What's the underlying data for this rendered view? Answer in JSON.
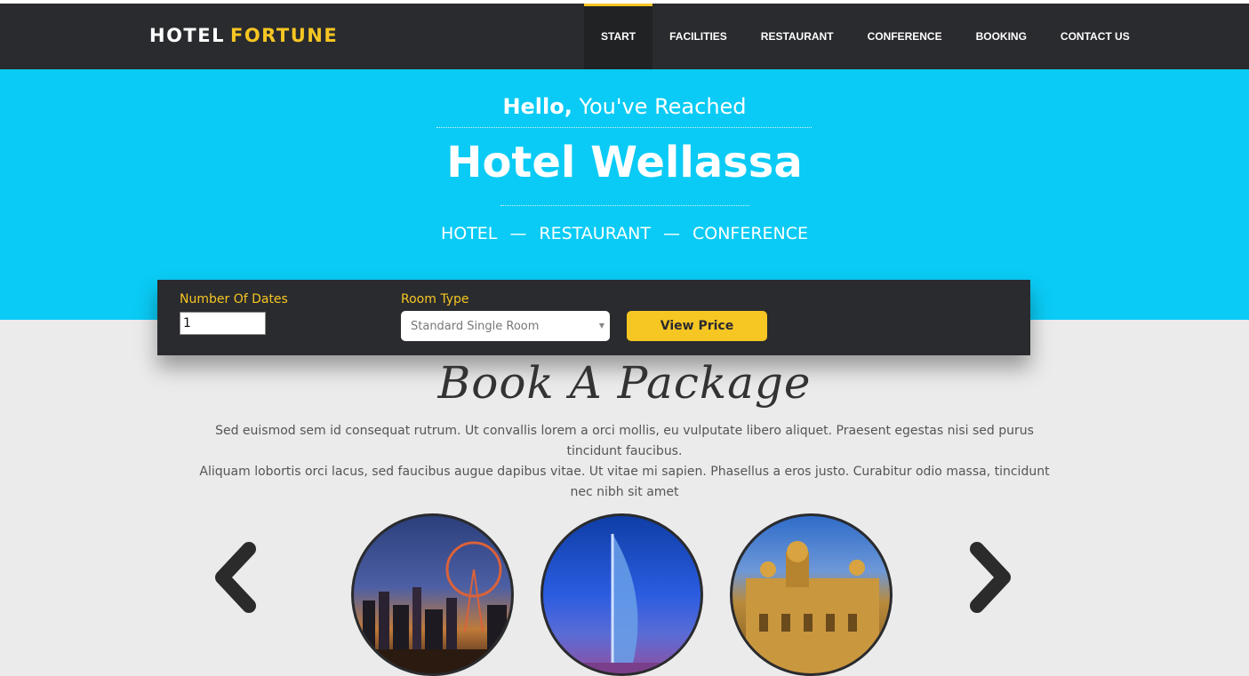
{
  "brand": {
    "part1": "HOTEL",
    "part2": "FORTUNE",
    "accent_color": "#f6c623"
  },
  "nav": {
    "items": [
      {
        "label": "START",
        "active": true
      },
      {
        "label": "FACILITIES",
        "active": false
      },
      {
        "label": "RESTAURANT",
        "active": false
      },
      {
        "label": "CONFERENCE",
        "active": false
      },
      {
        "label": "BOOKING",
        "active": false
      },
      {
        "label": "CONTACT US",
        "active": false
      }
    ]
  },
  "hero": {
    "hello_bold": "Hello,",
    "hello_rest": "You've Reached",
    "title": "Hotel Wellassa",
    "tags": [
      "HOTEL",
      "RESTAURANT",
      "CONFERENCE"
    ],
    "separator": "—",
    "background_color": "#0acbf5"
  },
  "booking": {
    "dates_label": "Number Of Dates",
    "dates_value": "1",
    "room_label": "Room Type",
    "room_selected": "Standard Single Room",
    "view_price_label": "View Price"
  },
  "packages": {
    "title": "Book A Package",
    "description_line1": "Sed euismod sem id consequat rutrum. Ut convallis lorem a orci mollis, eu vulputate libero aliquet. Praesent egestas nisi sed purus tincidunt faucibus.",
    "description_line2": "Aliquam lobortis orci lacus, sed faucibus augue dapibus vitae. Ut vitae mi sapien. Phasellus a eros justo. Curabitur odio massa, tincidunt nec nibh sit amet",
    "prev_icon": "chevron-left-icon",
    "next_icon": "chevron-right-icon"
  }
}
